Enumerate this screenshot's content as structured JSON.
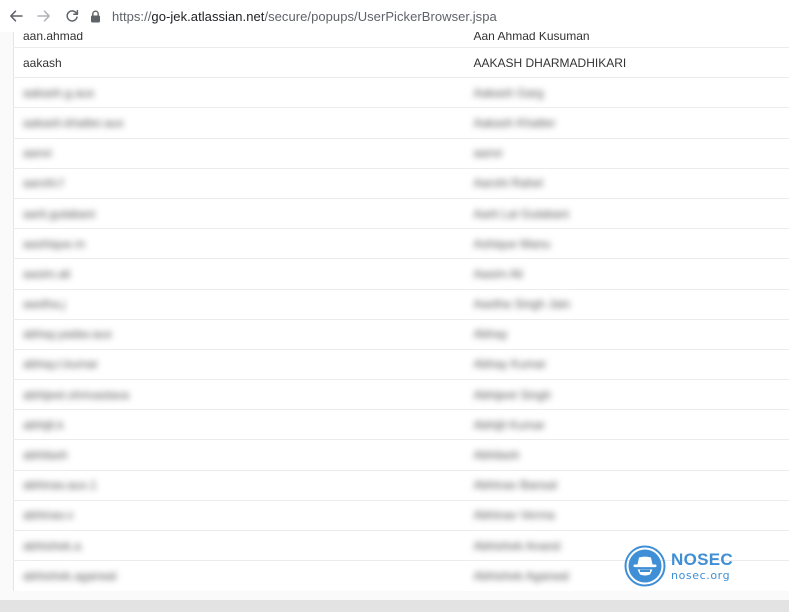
{
  "browser": {
    "url_scheme": "https://",
    "url_host": "go-jek.atlassian.net",
    "url_path": "/secure/popups/UserPickerBrowser.jspa"
  },
  "users": [
    {
      "username": "aan.ahmad",
      "full_name": "Aan Ahmad Kusuman",
      "blurred": false
    },
    {
      "username": "aakash",
      "full_name": "AAKASH DHARMADHIKARI",
      "blurred": false
    },
    {
      "username": "aakash.g.aux",
      "full_name": "Aakash Garg",
      "blurred": true
    },
    {
      "username": "aakash.khatter.aux",
      "full_name": "Aakash Khatter",
      "blurred": true
    },
    {
      "username": "aanvi",
      "full_name": "aanvi",
      "blurred": true
    },
    {
      "username": "aarohi.f",
      "full_name": "Aarohi Rahel",
      "blurred": true
    },
    {
      "username": "aarti.gulabani",
      "full_name": "Aarti Lal Gulabani",
      "blurred": true
    },
    {
      "username": "aashique.m",
      "full_name": "Ashique Manu",
      "blurred": true
    },
    {
      "username": "aasim.ali",
      "full_name": "Aasim Ali",
      "blurred": true
    },
    {
      "username": "aastha.j",
      "full_name": "Aastha Singh Jain",
      "blurred": true
    },
    {
      "username": "abhay.yadav.aux",
      "full_name": "Abhay",
      "blurred": true
    },
    {
      "username": "abhay.t.kumar",
      "full_name": "Abhay Kumar",
      "blurred": true
    },
    {
      "username": "abhijeet.shrivastava",
      "full_name": "Abhijeet Singh",
      "blurred": true
    },
    {
      "username": "abhijit.k",
      "full_name": "Abhijit Kumar",
      "blurred": true
    },
    {
      "username": "abhilash",
      "full_name": "Abhilash",
      "blurred": true
    },
    {
      "username": "abhinav.aux.1",
      "full_name": "Abhinav Bansal",
      "blurred": true
    },
    {
      "username": "abhinav.v",
      "full_name": "Abhinav Verma",
      "blurred": true
    },
    {
      "username": "abhishek.a",
      "full_name": "Abhishek Anand",
      "blurred": true
    },
    {
      "username": "abhishek.agarwal",
      "full_name": "Abhishek Agarwal",
      "blurred": true
    }
  ],
  "watermark": {
    "brand": "NOSEC",
    "site": "nosec.org"
  },
  "icons": {
    "back": "arrow-left-icon",
    "forward": "arrow-right-icon",
    "reload": "reload-icon",
    "lock": "lock-icon",
    "watermark_logo": "detective-hat-icon"
  },
  "colors": {
    "watermark_blue": "#3f8fd6",
    "row_border": "#ececec",
    "bottom_bar": "#e3e3e3"
  }
}
